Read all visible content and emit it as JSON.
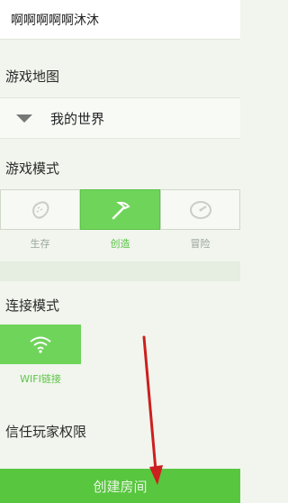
{
  "room": {
    "name_value": "啊啊啊啊啊沐沐"
  },
  "map": {
    "section_title": "游戏地图",
    "selected": "我的世界"
  },
  "game_mode": {
    "section_title": "游戏模式",
    "modes": [
      {
        "label": "生存",
        "icon": "bread-icon",
        "active": false
      },
      {
        "label": "创造",
        "icon": "pickaxe-icon",
        "active": true
      },
      {
        "label": "冒险",
        "icon": "compass-icon",
        "active": false
      }
    ]
  },
  "connection": {
    "section_title": "连接模式",
    "wifi_label": "WIFI链接",
    "icon": "wifi-icon"
  },
  "trust": {
    "section_title": "信任玩家权限"
  },
  "create_button": {
    "label": "创建房间"
  },
  "colors": {
    "accent": "#6fd45a",
    "active_text": "#5cc447",
    "arrow": "#cc1f1f"
  }
}
